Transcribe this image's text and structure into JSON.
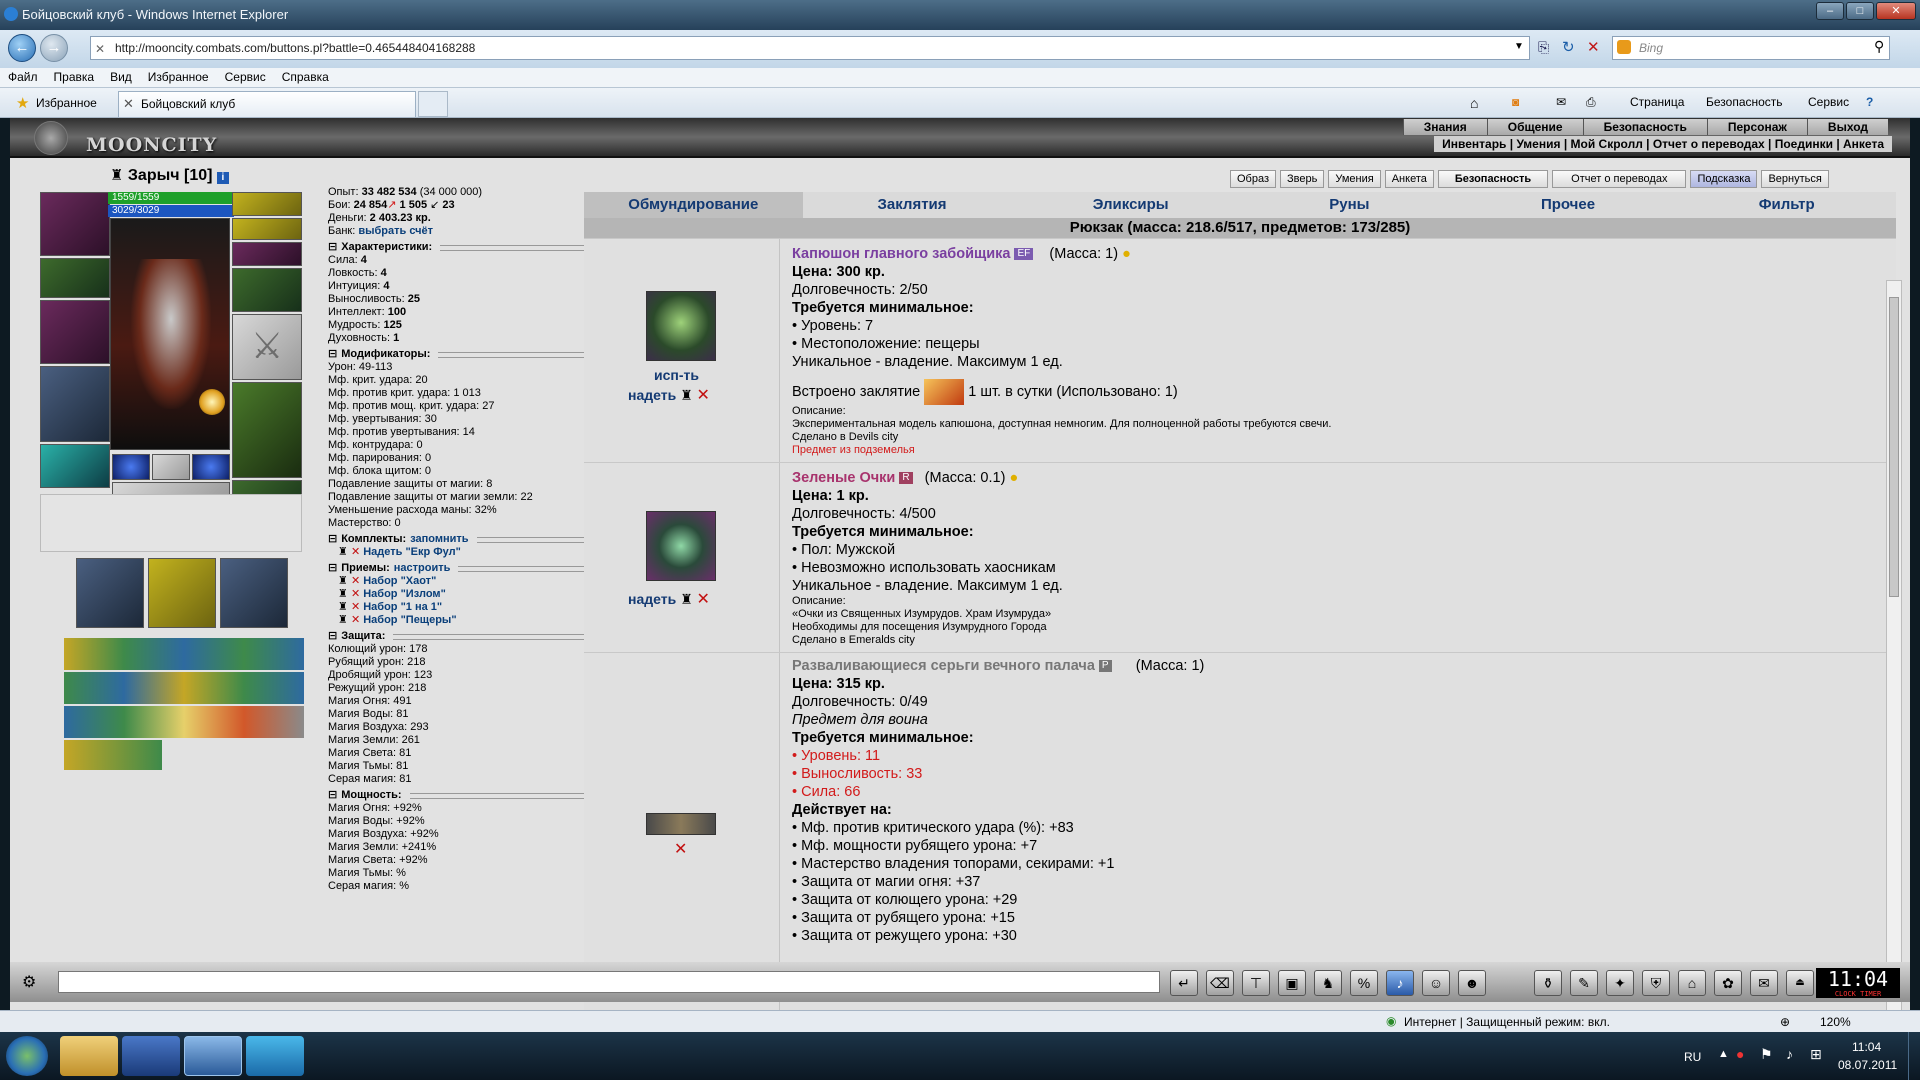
{
  "window": {
    "title": "Бойцовский клуб - Windows Internet Explorer"
  },
  "address": {
    "url": "http://mooncity.combats.com/buttons.pl?battle=0.465448404168288",
    "search_placeholder": "Bing"
  },
  "menu": [
    "Файл",
    "Правка",
    "Вид",
    "Избранное",
    "Сервис",
    "Справка"
  ],
  "favorites": {
    "label": "Избранное",
    "tab": "Бойцовский клуб"
  },
  "commandbar": {
    "page": "Страница",
    "security": "Безопасность",
    "service": "Сервис"
  },
  "site": {
    "logo": "MOONCITY",
    "nav_top": [
      "Знания",
      "Общение",
      "Безопасность",
      "Персонаж",
      "Выход"
    ],
    "nav_sub": "Инвентарь | Умения | Мой Скролл | Отчет о переводах | Поединки | Анкета",
    "subnav": [
      "Образ",
      "Зверь",
      "Умения",
      "Анкета",
      "Безопасность",
      "Отчет о переводах",
      "Подсказка",
      "Вернуться"
    ]
  },
  "character": {
    "name": "Зарыч [10]",
    "hp": "1559/1559",
    "mana": "3029/3029",
    "experience_label": "Опыт:",
    "experience": "33 482 534",
    "experience_next": "(34 000 000)",
    "battles_label": "Бои:",
    "battles": "24 854",
    "wins": "1 505",
    "losses": "23",
    "money_label": "Деньги:",
    "money": "2 403.23 кр.",
    "bank_label": "Банк:",
    "bank_link": "выбрать счёт"
  },
  "characteristics": {
    "title": "Характеристики:",
    "rows": [
      {
        "label": "Сила:",
        "value": "4"
      },
      {
        "label": "Ловкость:",
        "value": "4"
      },
      {
        "label": "Интуиция:",
        "value": "4"
      },
      {
        "label": "Выносливость:",
        "value": "25"
      },
      {
        "label": "Интеллект:",
        "value": "100"
      },
      {
        "label": "Мудрость:",
        "value": "125"
      },
      {
        "label": "Духовность:",
        "value": "1"
      }
    ]
  },
  "modifiers": {
    "title": "Модификаторы:",
    "rows": [
      "Урон: 49-113",
      "Мф. крит. удара: 20",
      "Мф. против крит. удара: 1 013",
      "Мф. против мощ. крит. удара: 27",
      "Мф. увертывания: 30",
      "Мф. против увертывания: 14",
      "Мф. контрудара: 0",
      "Мф. парирования: 0",
      "Мф. блока щитом: 0",
      "Подавление защиты от магии: 8",
      "Подавление защиты от магии земли: 22",
      "Уменьшение расхода маны: 32%",
      "Мастерство: 0"
    ]
  },
  "sets": {
    "title": "Комплекты:",
    "action": "запомнить",
    "items": [
      "Надеть \"Екр Фул\""
    ]
  },
  "techniques": {
    "title": "Приемы:",
    "action": "настроить",
    "items": [
      "Набор \"Хаот\"",
      "Набор \"Излом\"",
      "Набор \"1 на 1\"",
      "Набор \"Пещеры\""
    ]
  },
  "defense": {
    "title": "Защита:",
    "rows": [
      "Колющий урон: 178",
      "Рубящий урон: 218",
      "Дробящий урон: 123",
      "Режущий урон: 218",
      "Магия Огня: 491",
      "Магия Воды: 81",
      "Магия Воздуха: 293",
      "Магия Земли: 261",
      "Магия Света: 81",
      "Магия Тьмы: 81",
      "Серая магия: 81"
    ]
  },
  "power": {
    "title": "Мощность:",
    "rows": [
      "Магия Огня: +92%",
      "Магия Воды: +92%",
      "Магия Воздуха: +92%",
      "Магия Земли: +241%",
      "Магия Света: +92%",
      "Магия Тьмы: %",
      "Серая магия: %"
    ]
  },
  "inventory": {
    "tabs": [
      "Обмундирование",
      "Заклятия",
      "Эликсиры",
      "Руны",
      "Прочее",
      "Фильтр"
    ],
    "backpack": "Рюкзак (масса: 218.6/517, предметов: 173/285)",
    "items": [
      {
        "name": "Капюшон главного забойщика",
        "badge": "EF",
        "mass": "(Масса: 1)",
        "price": "Цена: 300 кр.",
        "durability": "Долговечность: 2/50",
        "req_title": "Требуется минимальное:",
        "reqs": [
          "• Уровень: 7",
          "• Местоположение: пещеры"
        ],
        "unique": "Уникальное - владение. Максимум 1 ед.",
        "spell_pre": "Встроено заклятие",
        "spell_post": "1 шт. в сутки (Использовано: 1)",
        "desc_title": "Описание:",
        "desc": "Экспериментальная модель капюшона, доступная немногим. Для полноценной работы требуются свечи.",
        "made": "Сделано в Devils city",
        "note": "Предмет из подземелья",
        "actions": [
          "исп-ть",
          "надеть"
        ]
      },
      {
        "name": "Зеленые Очки",
        "badge": "R",
        "mass": "(Масса: 0.1)",
        "price": "Цена: 1 кр.",
        "durability": "Долговечность: 4/500",
        "req_title": "Требуется минимальное:",
        "reqs": [
          "• Пол: Мужской",
          "• Невозможно использовать хаосникам"
        ],
        "unique": "Уникальное - владение. Максимум 1 ед.",
        "desc_title": "Описание:",
        "desc1": "«Очки из Священных Изумрудов. Храм Изумруда»",
        "desc2": "Необходимы для посещения Изумрудного Города",
        "made": "Сделано в Emeralds city",
        "actions": [
          "надеть"
        ]
      },
      {
        "name": "Разваливающиеся серьги вечного палача",
        "badge": "P",
        "mass": "(Масса: 1)",
        "price": "Цена: 315 кр.",
        "durability": "Долговечность: 0/49",
        "class": "Предмет для воина",
        "req_title": "Требуется минимальное:",
        "reqs": [
          "• Уровень: 11",
          "• Выносливость: 33",
          "• Сила: 66"
        ],
        "acts_title": "Действует на:",
        "acts": [
          "• Мф. против критического удара (%): +83",
          "• Мф. мощности рубящего урона: +7",
          "• Мастерство владения топорами, секирами: +1",
          "• Защита от магии огня: +37",
          "• Защита от колющего урона: +29",
          "• Защита от рубящего урона: +15",
          "• Защита от режущего урона: +30"
        ]
      }
    ]
  },
  "clock": {
    "time": "11:04",
    "labels": "CLOCK TIMER"
  },
  "statusbar": {
    "zone": "Интернет | Защищенный режим: вкл.",
    "zoom": "120%"
  },
  "taskbar": {
    "lang": "RU",
    "time": "11:04",
    "date": "08.07.2011"
  },
  "colors": {
    "link": "#0a3f7a",
    "tab_active": "#bfbfbf",
    "requirement_unmet": "#d21b1b",
    "item_epic": "#7a3fa0",
    "item_rare": "#a8336d"
  }
}
